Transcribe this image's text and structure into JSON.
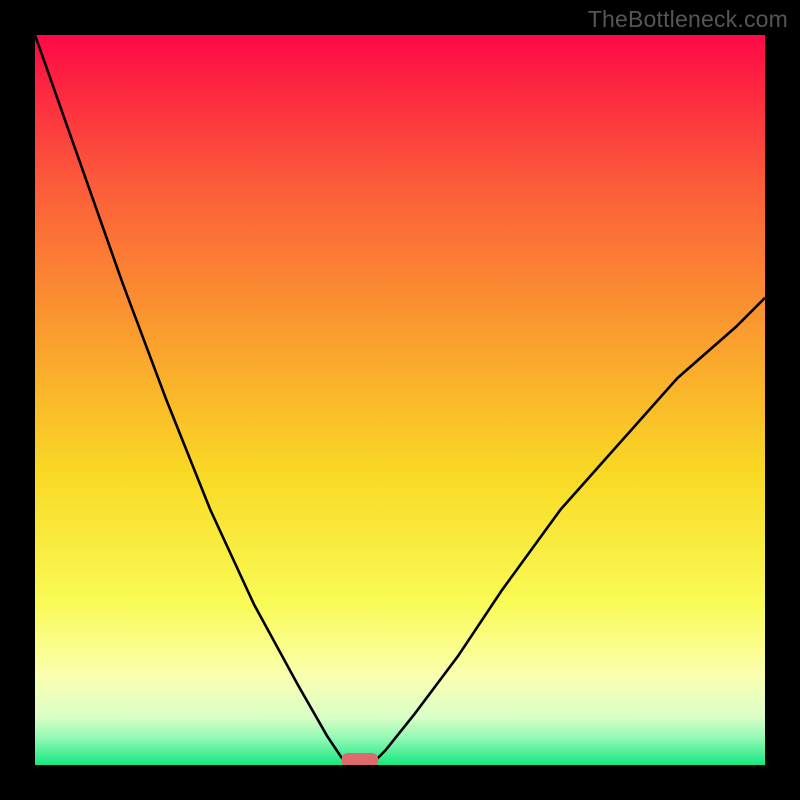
{
  "watermark": "TheBottleneck.com",
  "chart_data": {
    "type": "line",
    "title": "",
    "xlabel": "",
    "ylabel": "",
    "xlim": [
      0,
      100
    ],
    "ylim": [
      0,
      100
    ],
    "grid": false,
    "series": [
      {
        "name": "left-curve",
        "x": [
          0,
          6,
          12,
          18,
          24,
          30,
          36,
          40,
          42,
          43
        ],
        "y": [
          100,
          83,
          66,
          50,
          35,
          22,
          11,
          4,
          1,
          0
        ]
      },
      {
        "name": "right-curve",
        "x": [
          46,
          48,
          52,
          58,
          64,
          72,
          80,
          88,
          96,
          100
        ],
        "y": [
          0,
          2,
          7,
          15,
          24,
          35,
          44,
          53,
          60,
          64
        ]
      }
    ],
    "marker": {
      "name": "bottleneck-marker",
      "x_center": 44.5,
      "y": 0,
      "width": 5,
      "color": "#df6a6d"
    },
    "background_gradient": {
      "stops": [
        {
          "offset": 0.0,
          "color": "#fe0945"
        },
        {
          "offset": 0.2,
          "color": "#fc5a3a"
        },
        {
          "offset": 0.4,
          "color": "#fa9a2f"
        },
        {
          "offset": 0.6,
          "color": "#f9d924"
        },
        {
          "offset": 0.78,
          "color": "#f9fb57"
        },
        {
          "offset": 0.88,
          "color": "#faffb1"
        },
        {
          "offset": 0.935,
          "color": "#d9ffc7"
        },
        {
          "offset": 0.965,
          "color": "#8cf8b1"
        },
        {
          "offset": 1.0,
          "color": "#15e87f"
        }
      ]
    }
  }
}
